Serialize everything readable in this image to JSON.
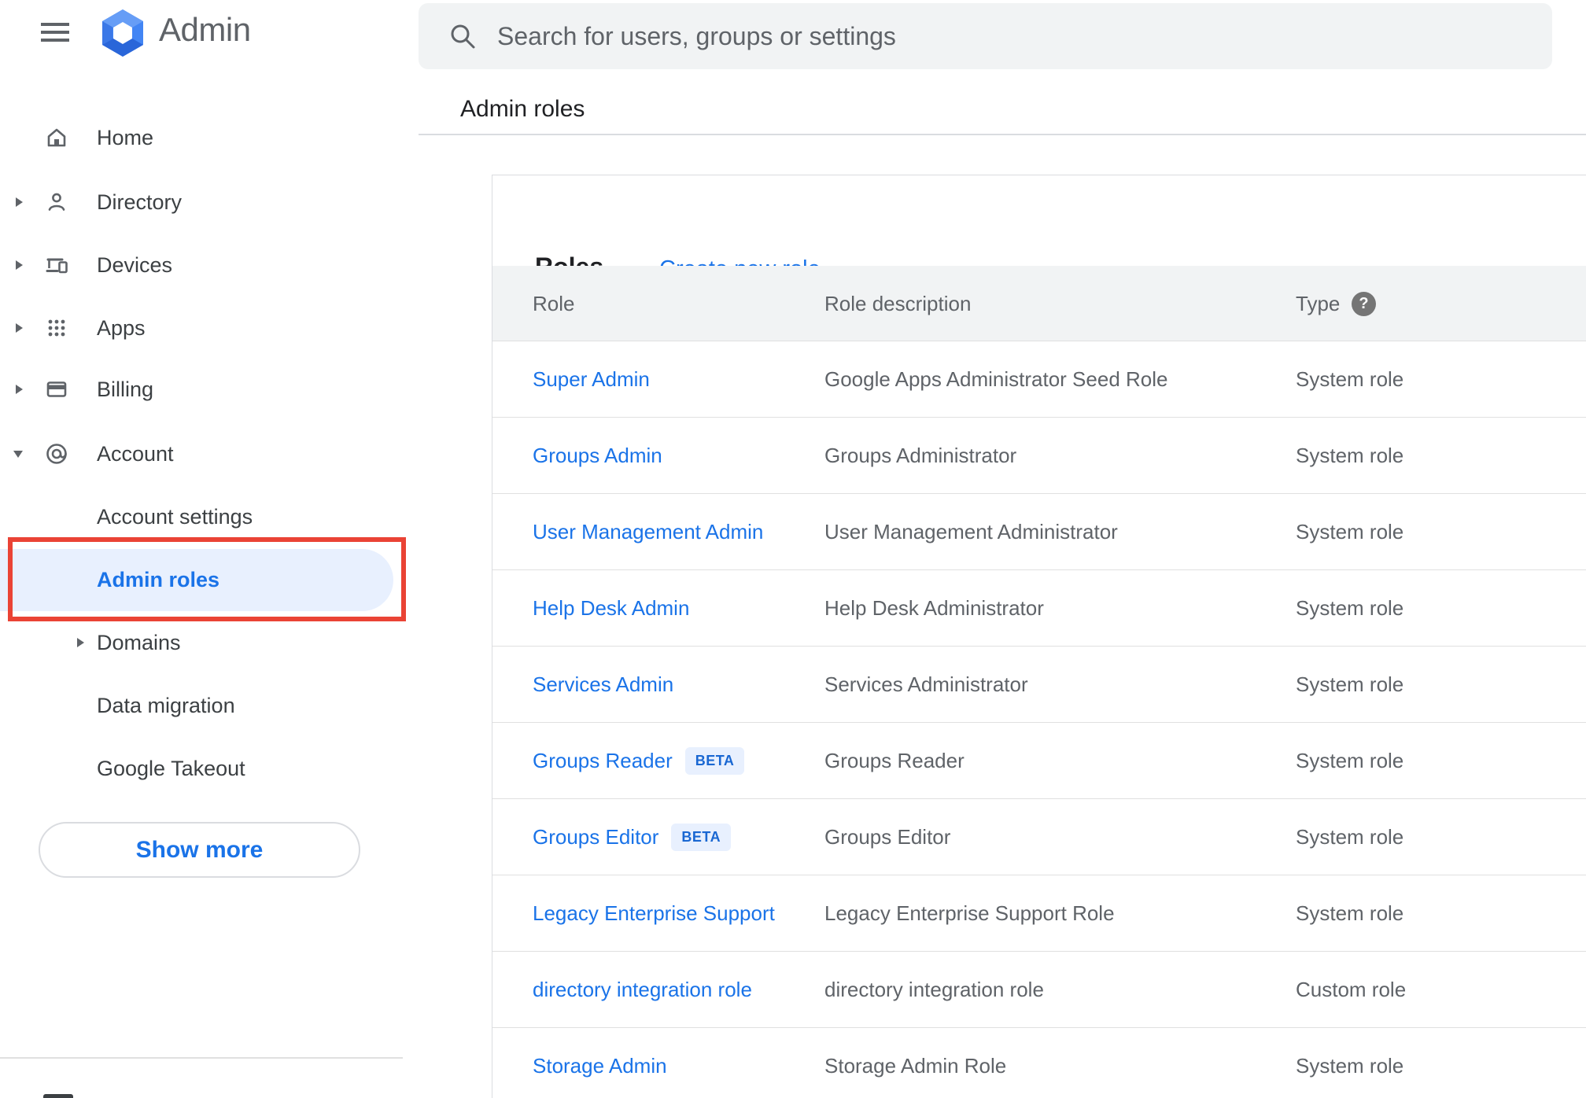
{
  "app": {
    "logo_text": "Admin"
  },
  "search": {
    "placeholder": "Search for users, groups or settings"
  },
  "breadcrumb": "Admin roles",
  "sidebar": {
    "items": [
      {
        "label": "Home"
      },
      {
        "label": "Directory"
      },
      {
        "label": "Devices"
      },
      {
        "label": "Apps"
      },
      {
        "label": "Billing"
      },
      {
        "label": "Account"
      },
      {
        "label": "Account settings"
      },
      {
        "label": "Admin roles"
      },
      {
        "label": "Domains"
      },
      {
        "label": "Data migration"
      },
      {
        "label": "Google Takeout"
      }
    ],
    "show_more_label": "Show more",
    "selected_item": "Admin roles"
  },
  "card": {
    "title": "Roles",
    "create_link": "Create new role",
    "columns": {
      "role": "Role",
      "description": "Role description",
      "type": "Type"
    },
    "beta_label": "BETA",
    "rows": [
      {
        "role": "Super Admin",
        "description": "Google Apps Administrator Seed Role",
        "type": "System role"
      },
      {
        "role": "Groups Admin",
        "description": "Groups Administrator",
        "type": "System role"
      },
      {
        "role": "User Management Admin",
        "description": "User Management Administrator",
        "type": "System role"
      },
      {
        "role": "Help Desk Admin",
        "description": "Help Desk Administrator",
        "type": "System role"
      },
      {
        "role": "Services Admin",
        "description": "Services Administrator",
        "type": "System role"
      },
      {
        "role": "Groups Reader",
        "description": "Groups Reader",
        "type": "System role"
      },
      {
        "role": "Groups Editor",
        "description": "Groups Editor",
        "type": "System role"
      },
      {
        "role": "Legacy Enterprise Support",
        "description": "Legacy Enterprise Support Role",
        "type": "System role"
      },
      {
        "role": "directory integration role",
        "description": "directory integration role",
        "type": "Custom role"
      },
      {
        "role": "Storage Admin",
        "description": "Storage Admin Role",
        "type": "System role"
      }
    ]
  },
  "colors": {
    "link_blue": "#1a73e8",
    "selected_pill_bg": "#e8f0fe",
    "annotation_red": "#ea4335",
    "header_band_bg": "#f1f3f4",
    "search_bg": "#f1f3f4",
    "icon_gray": "#5f6368",
    "text_dark": "#202124",
    "divider_gray": "#dadce0",
    "beta_text": "#1967d2"
  }
}
